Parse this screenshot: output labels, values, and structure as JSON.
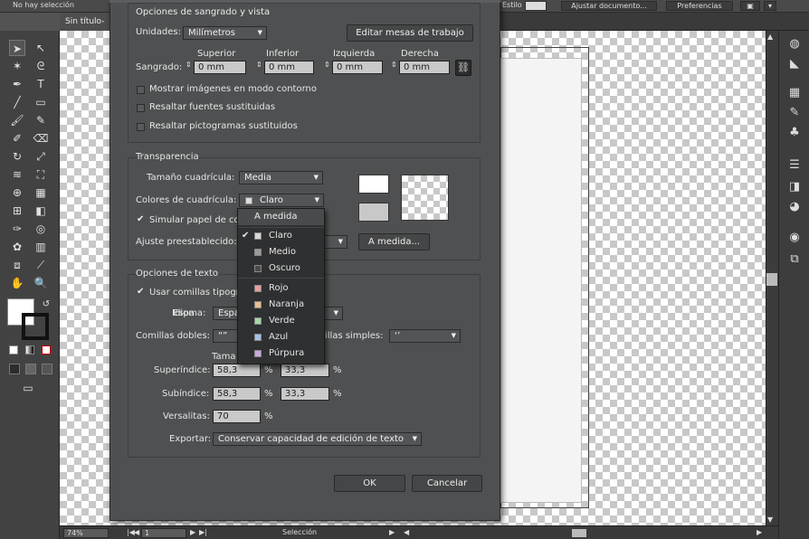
{
  "topbar": {
    "selection_status": "No hay selección",
    "style_label": "Estilo",
    "document_setup": "Ajustar documento...",
    "preferences": "Preferencias"
  },
  "document_tab": "Sin título-",
  "status": {
    "zoom": "74%",
    "page": "1",
    "tool": "Selección"
  },
  "dialog": {
    "bleed_section": {
      "title": "Opciones de sangrado y vista",
      "units_label": "Unidades:",
      "units_value": "Milímetros",
      "edit_artboards": "Editar mesas de trabajo",
      "bleed_label": "Sangrado:",
      "columns": [
        "Superior",
        "Inferior",
        "Izquierda",
        "Derecha"
      ],
      "values": [
        "0 mm",
        "0 mm",
        "0 mm",
        "0 mm"
      ],
      "link_icon": "link-chain-icon",
      "options": [
        {
          "label": "Mostrar imágenes en modo contorno",
          "checked": false
        },
        {
          "label": "Resaltar fuentes sustituidas",
          "checked": false
        },
        {
          "label": "Resaltar pictogramas sustituidos",
          "checked": false
        }
      ]
    },
    "transparency_section": {
      "title": "Transparencia",
      "grid_size_label": "Tamaño cuadrícula:",
      "grid_size_value": "Media",
      "grid_colors_label": "Colores de cuadrícula:",
      "grid_colors_value": "Claro",
      "simulate_paper": "Simular papel de co",
      "preset_label": "Ajuste preestablecido:",
      "custom_button": "A medida..."
    },
    "text_section": {
      "title": "Opciones de texto",
      "typographic_quotes": "Usar comillas tipogr",
      "language_label": "Idioma:",
      "language_value": "Espa",
      "double_quotes_label": "Comillas dobles:",
      "double_quotes_value": "“”",
      "single_quotes_label": "illas simples:",
      "single_quotes_value": "‘’",
      "size_header": "Tama",
      "superscript_label": "Superíndice:",
      "superscript_size": "58,3",
      "superscript_pos": "33,3",
      "subscript_label": "Subíndice:",
      "subscript_size": "58,3",
      "subscript_pos": "33,3",
      "smallcaps_label": "Versalitas:",
      "smallcaps_value": "70",
      "percent": "%",
      "export_label": "Exportar:",
      "export_value": "Conservar capacidad de edición de texto"
    },
    "ok": "OK",
    "cancel": "Cancelar"
  },
  "dropdown": {
    "header": "A medida",
    "items": [
      {
        "label": "Claro",
        "checked": true,
        "color": "#d8d8d8"
      },
      {
        "label": "Medio",
        "checked": false,
        "color": "#9a9a9a"
      },
      {
        "label": "Oscuro",
        "checked": false,
        "color": "#4a4a4a"
      },
      {
        "label": "Rojo",
        "checked": false,
        "color": "#e8a0a0"
      },
      {
        "label": "Naranja",
        "checked": false,
        "color": "#e8c090"
      },
      {
        "label": "Verde",
        "checked": false,
        "color": "#a8d8a8"
      },
      {
        "label": "Azul",
        "checked": false,
        "color": "#a8c0e8"
      },
      {
        "label": "Púrpura",
        "checked": false,
        "color": "#c8a8e0"
      }
    ]
  },
  "colors": {
    "accent": "#4f5051",
    "canvas_check": "#c8c8c8"
  }
}
